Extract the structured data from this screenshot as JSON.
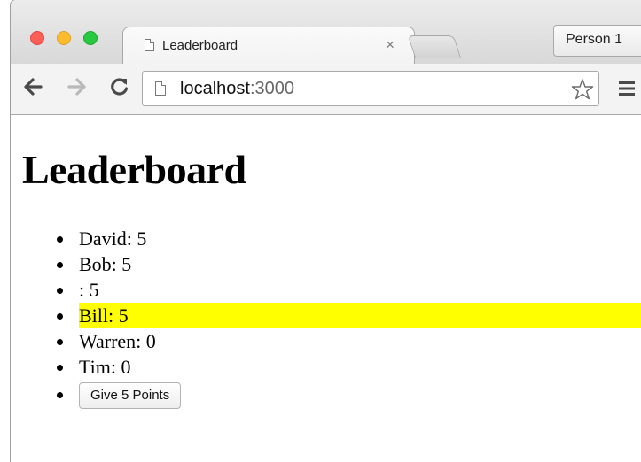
{
  "browser": {
    "tab_title": "Leaderboard",
    "tab_close": "×",
    "profile_label": "Person 1",
    "url_host": "localhost",
    "url_port": ":3000"
  },
  "page": {
    "title": "Leaderboard",
    "players": [
      {
        "name": "David",
        "score": 5,
        "selected": false
      },
      {
        "name": "Bob",
        "score": 5,
        "selected": false
      },
      {
        "name": "",
        "score": 5,
        "selected": false
      },
      {
        "name": "Bill",
        "score": 5,
        "selected": true
      },
      {
        "name": "Warren",
        "score": 0,
        "selected": false
      },
      {
        "name": "Tim",
        "score": 0,
        "selected": false
      }
    ],
    "give_button_label": "Give 5 Points"
  },
  "colors": {
    "selected_highlight": "#ffff00",
    "close_button": "#fc5f57",
    "minimize_button": "#fdbc2e",
    "zoom_button": "#28c840"
  }
}
